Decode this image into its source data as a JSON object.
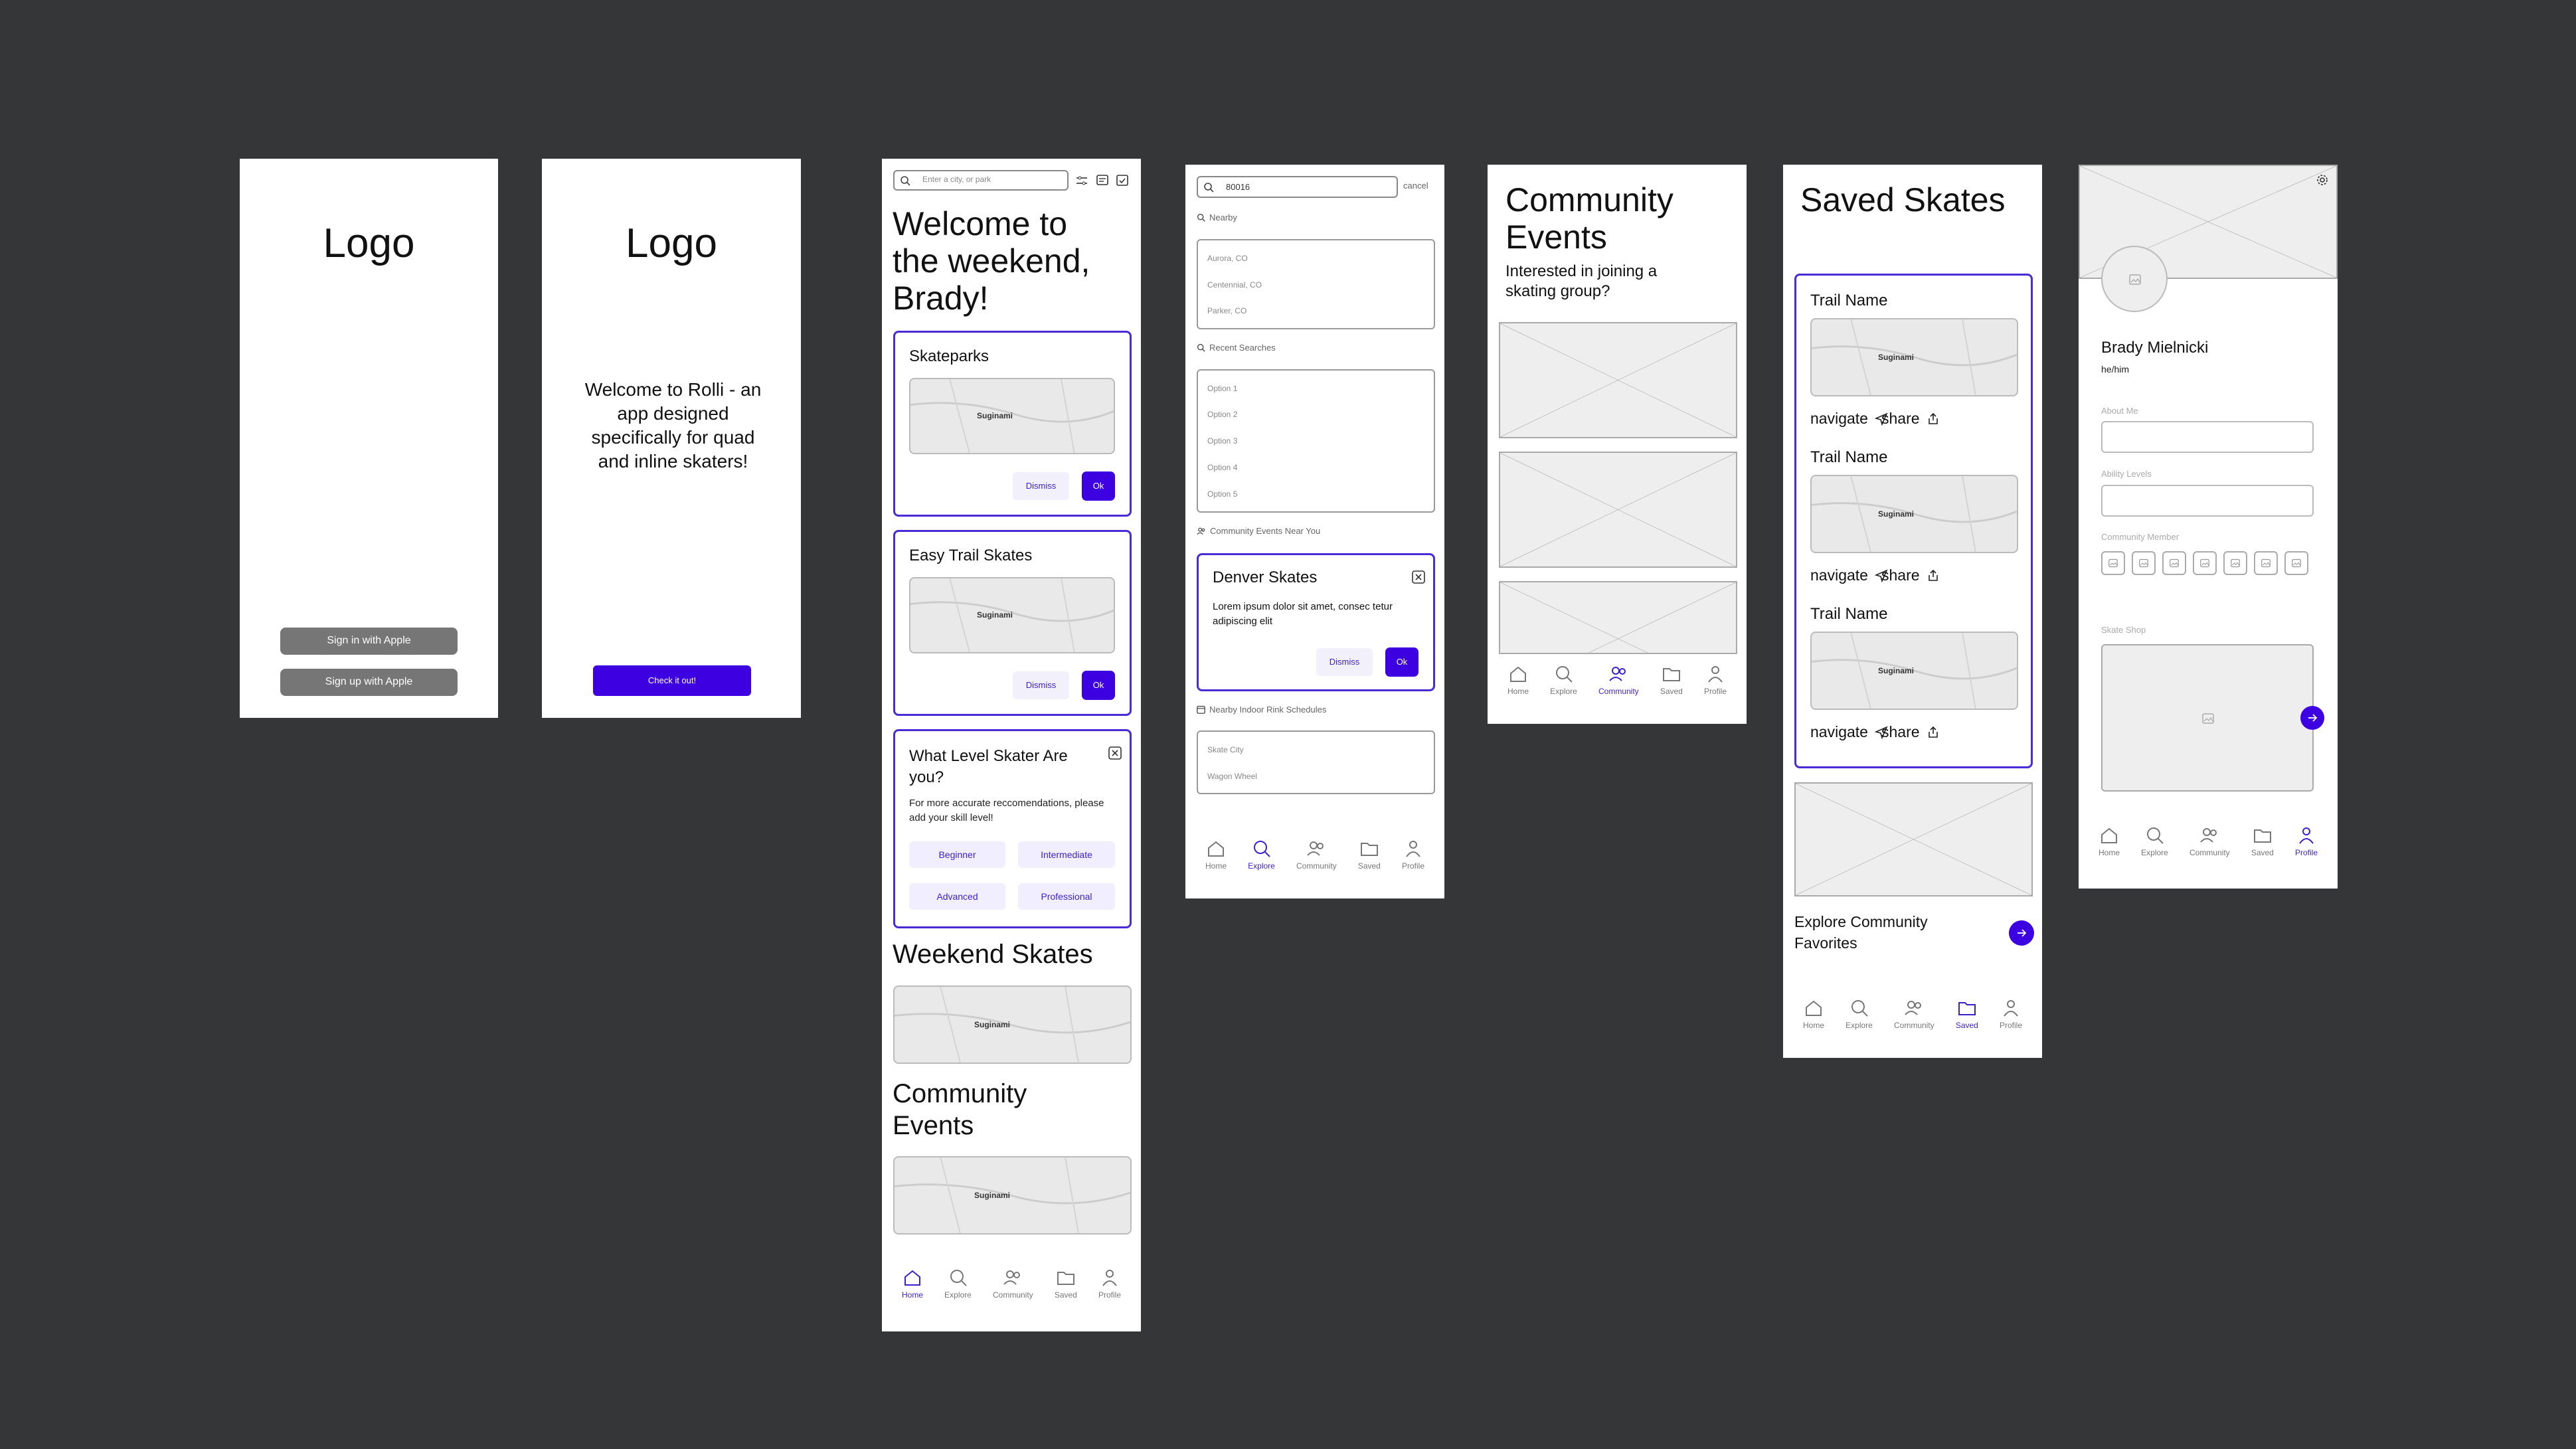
{
  "screen1": {
    "logo": "Logo",
    "sign_in": "Sign in with Apple",
    "sign_up": "Sign up with Apple"
  },
  "screen2": {
    "logo": "Logo",
    "welcome": "Welcome to Rolli - an app designed specifically for quad and inline skaters!",
    "cta": "Check it out!"
  },
  "home": {
    "search_placeholder": "Enter a city, or park",
    "greeting": "Welcome to the weekend, Brady!",
    "cards": [
      {
        "title": "Skateparks",
        "dismiss": "Dismiss",
        "ok": "Ok"
      },
      {
        "title": "Easy Trail Skates",
        "dismiss": "Dismiss",
        "ok": "Ok"
      }
    ],
    "level_card": {
      "title": "What Level Skater Are you?",
      "body": "For more accurate reccomendations, please add your skill level!",
      "options": [
        "Beginner",
        "Intermediate",
        "Advanced",
        "Professional"
      ]
    },
    "weekend_title": "Weekend Skates",
    "community_title": "Community Events",
    "map_label": "Suginami"
  },
  "explore": {
    "search_value": "80016",
    "cancel": "cancel",
    "nearby_label": "Nearby",
    "nearby": [
      "Aurora, CO",
      "Centennial, CO",
      "Parker, CO"
    ],
    "recent_label": "Recent Searches",
    "recent": [
      "Option 1",
      "Option 2",
      "Option 3",
      "Option 4",
      "Option 5"
    ],
    "events_label": "Community Events Near You",
    "event": {
      "title": "Denver Skates",
      "body": "Lorem ipsum dolor sit amet, consec tetur adipiscing elit",
      "dismiss": "Dismiss",
      "ok": "Ok"
    },
    "rink_label": "Nearby Indoor Rink Schedules",
    "rinks": [
      "Skate City",
      "Wagon Wheel"
    ]
  },
  "community": {
    "title": "Community Events",
    "subtitle": "Interested in joining a skating group?"
  },
  "saved": {
    "title": "Saved Skates",
    "trail_name": "Trail Name",
    "navigate": "navigate",
    "share": "share",
    "explore_cta": "Explore Community Favorites"
  },
  "profile": {
    "name": "Brady Mielnicki",
    "pronouns": "he/him",
    "about_label": "About Me",
    "ability_label": "Ability Levels",
    "member_label": "Community Member",
    "shop_label": "Skate Shop"
  },
  "nav": [
    "Home",
    "Explore",
    "Community",
    "Saved",
    "Profile"
  ],
  "colors": {
    "accent": "#3d00e0",
    "background": "#343638"
  }
}
